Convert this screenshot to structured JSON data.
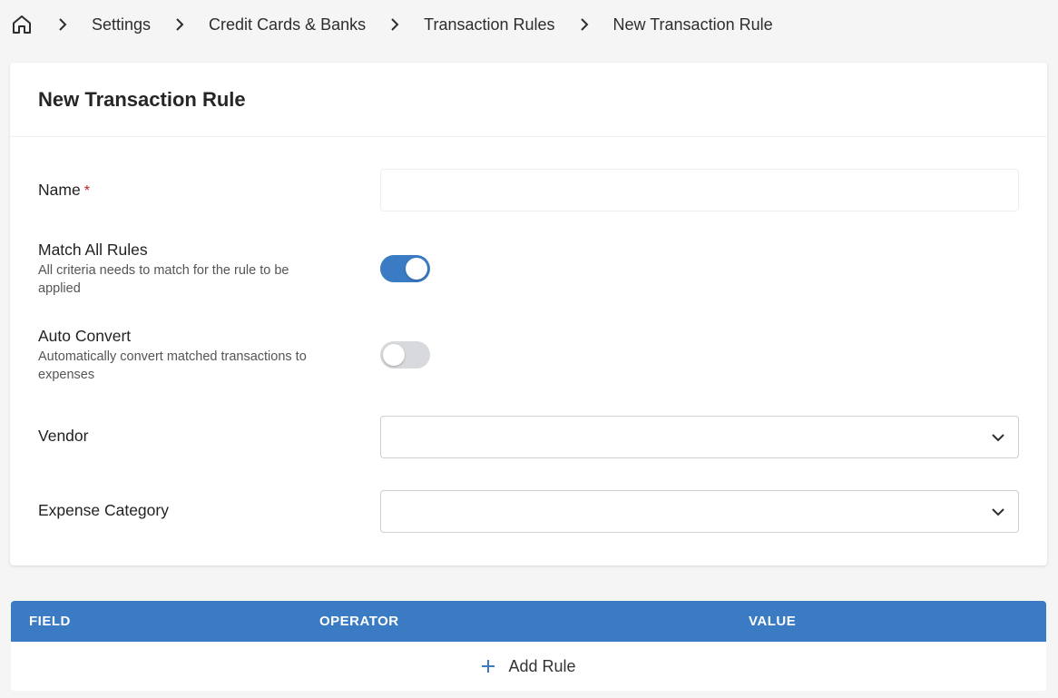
{
  "breadcrumb": {
    "home_icon": "home-icon",
    "items": [
      "Settings",
      "Credit Cards & Banks",
      "Transaction Rules",
      "New Transaction Rule"
    ]
  },
  "form": {
    "title": "New Transaction Rule",
    "name": {
      "label": "Name",
      "required_mark": "*",
      "value": ""
    },
    "match_all": {
      "label": "Match All Rules",
      "description": "All criteria needs to match for the rule to be applied",
      "enabled": true
    },
    "auto_convert": {
      "label": "Auto Convert",
      "description": "Automatically convert matched transactions to expenses",
      "enabled": false
    },
    "vendor": {
      "label": "Vendor",
      "value": ""
    },
    "expense_category": {
      "label": "Expense Category",
      "value": ""
    }
  },
  "rules_table": {
    "columns": [
      "FIELD",
      "OPERATOR",
      "VALUE"
    ],
    "add_label": "Add Rule"
  },
  "colors": {
    "accent": "#3a7bc4",
    "required": "#c0202a",
    "toggle_off": "#d7d9dd"
  }
}
